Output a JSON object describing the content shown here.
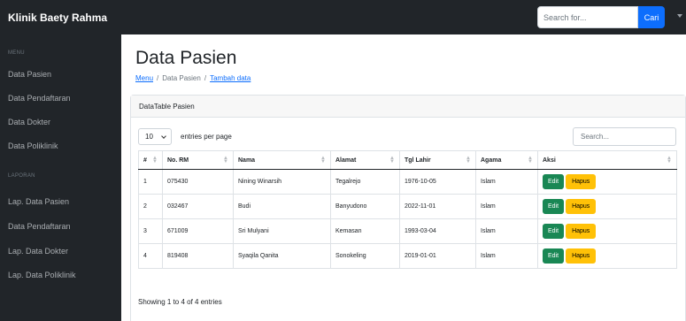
{
  "navbar": {
    "brand": "Klinik Baety Rahma",
    "search_placeholder": "Search for...",
    "search_button": "Cari"
  },
  "sidebar": {
    "heading_menu": "MENU",
    "menu_items": [
      "Data Pasien",
      "Data Pendaftaran",
      "Data Dokter",
      "Data Poliklinik"
    ],
    "heading_laporan": "LAPORAN",
    "laporan_items": [
      "Lap. Data Pasien",
      "Data Pendaftaran",
      "Lap. Data Dokter",
      "Lap. Data Poliklinik"
    ]
  },
  "page": {
    "title": "Data Pasien",
    "breadcrumb": [
      "Menu",
      "/",
      "Data Pasien",
      "/",
      "Tambah data"
    ]
  },
  "card": {
    "header": "DataTable Pasien",
    "entries_value": "10",
    "entries_label": "entries per page",
    "search_placeholder": "Search...",
    "columns": [
      "#",
      "No. RM",
      "Nama",
      "Alamat",
      "Tgl Lahir",
      "Agama",
      "Aksi"
    ],
    "rows": [
      {
        "no": "1",
        "rm": "075430",
        "nama": "Nining Winarsih",
        "alamat": "Tegalrejo",
        "tgl": "1976-10-05",
        "agama": "Islam"
      },
      {
        "no": "2",
        "rm": "032467",
        "nama": "Budi",
        "alamat": "Banyudono",
        "tgl": "2022-11-01",
        "agama": "Islam"
      },
      {
        "no": "3",
        "rm": "671009",
        "nama": "Sri Mulyani",
        "alamat": "Kemasan",
        "tgl": "1993-03-04",
        "agama": "Islam"
      },
      {
        "no": "4",
        "rm": "819408",
        "nama": "Syaqila Qanita",
        "alamat": "Sonokeling",
        "tgl": "2019-01-01",
        "agama": "Islam"
      }
    ],
    "edit_label": "Edit",
    "hapus_label": "Hapus",
    "info": "Showing 1 to 4 of 4 entries"
  },
  "colors": {
    "sidebar_bg": "#212529",
    "primary": "#0d6efd",
    "edit": "#198754",
    "hapus": "#ffc107"
  }
}
